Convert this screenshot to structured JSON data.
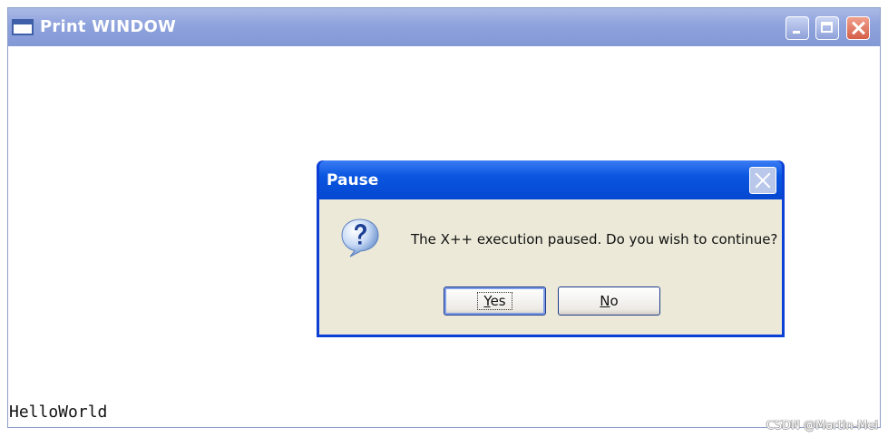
{
  "window": {
    "title": "Print WINDOW",
    "controls": [
      "minimize-icon",
      "maximize-icon",
      "close-icon"
    ],
    "output_text": "HelloWorld"
  },
  "dialog": {
    "title": "Pause",
    "icon": "question-icon",
    "message": "The X++ execution paused. Do you wish to continue?",
    "buttons": {
      "yes": {
        "mnemonic": "Y",
        "rest": "es",
        "label": "Yes"
      },
      "no": {
        "mnemonic": "N",
        "rest": "o",
        "label": "No"
      }
    }
  },
  "watermark": "CSDN @Martin-Mei",
  "colors": {
    "window_title_bar": "#8ea2dc",
    "dialog_title_bar": "#0a56e0",
    "dialog_body": "#ece9d8",
    "close_button": "#d55e48"
  }
}
